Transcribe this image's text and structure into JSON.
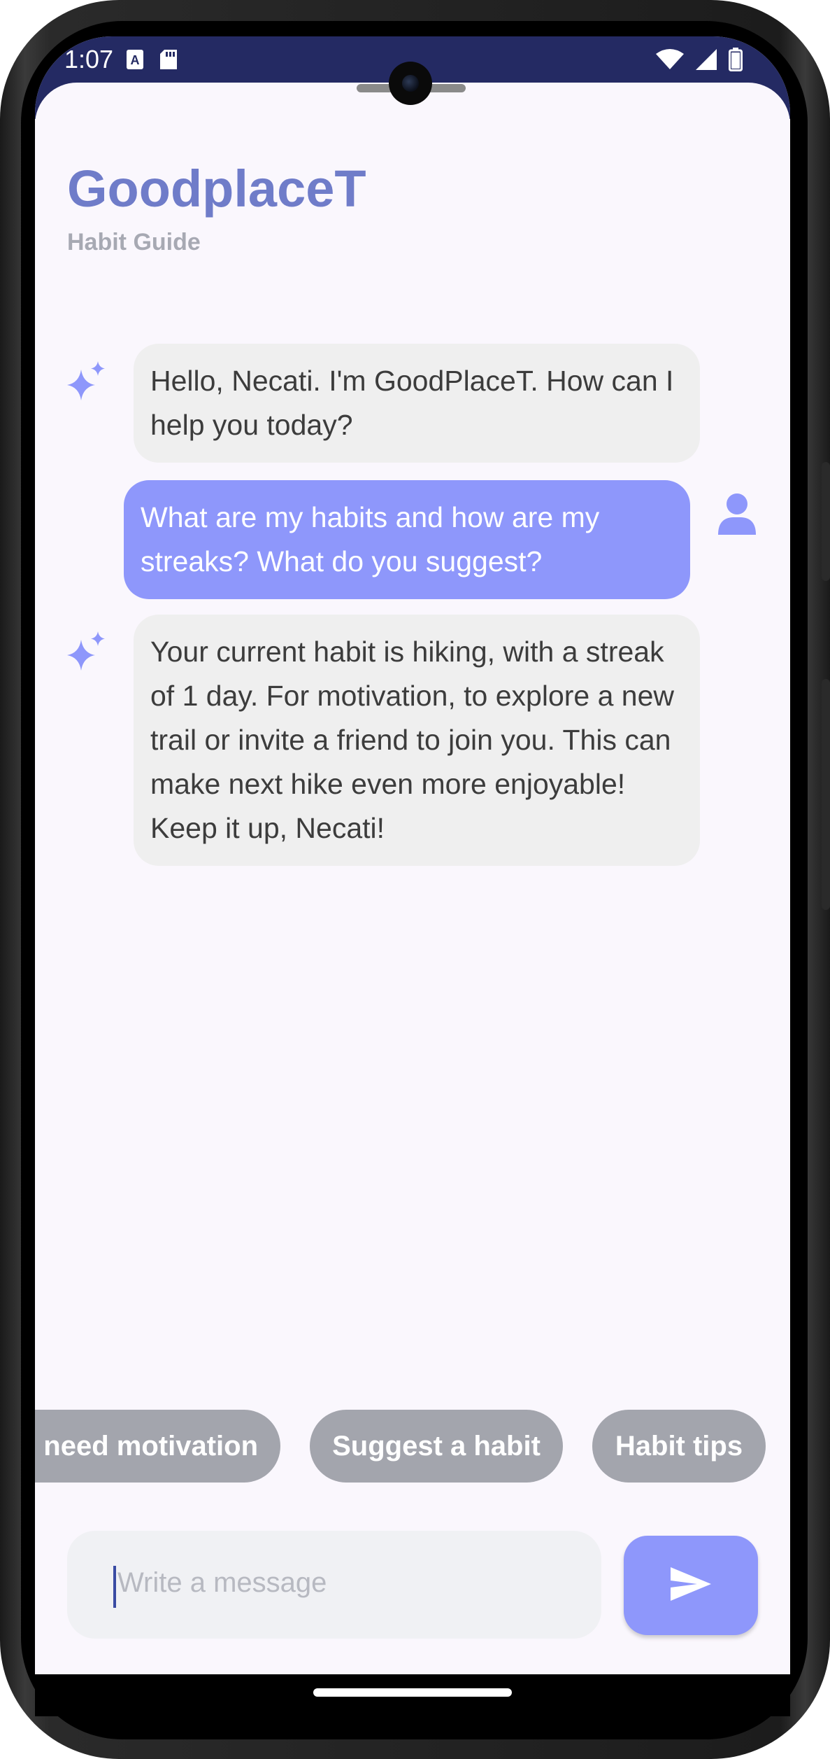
{
  "status_bar": {
    "time": "1:07",
    "icons_left": [
      "keyboard-a-icon",
      "sd-card-icon"
    ],
    "icons_right": [
      "wifi-icon",
      "signal-icon",
      "battery-icon"
    ]
  },
  "header": {
    "title": "GoodplaceT",
    "subtitle": "Habit Guide"
  },
  "messages": [
    {
      "role": "bot",
      "icon": "sparkle-icon",
      "text": "Hello, Necati. I'm GoodPlaceT. How can I help you today?"
    },
    {
      "role": "user",
      "icon": "person-icon",
      "text": "What are my habits and how are my streaks? What do you suggest?"
    },
    {
      "role": "bot",
      "icon": "sparkle-icon",
      "text": "Your current habit is hiking, with a streak of 1 day. For motivation, to explore a new trail or invite a friend to join you. This can make next hike even more enjoyable! Keep it up, Necati!"
    }
  ],
  "suggestions": [
    {
      "label": "need motivation"
    },
    {
      "label": "Suggest a habit"
    },
    {
      "label": "Habit tips"
    }
  ],
  "composer": {
    "placeholder": "Write a message",
    "send_icon": "send-icon"
  },
  "colors": {
    "status_bar": "#242a63",
    "accent": "#8e97fb",
    "title": "#6f7cc9",
    "chip": "#a3a5ad",
    "bot_bubble": "#efefef",
    "background": "#faf7fd"
  }
}
